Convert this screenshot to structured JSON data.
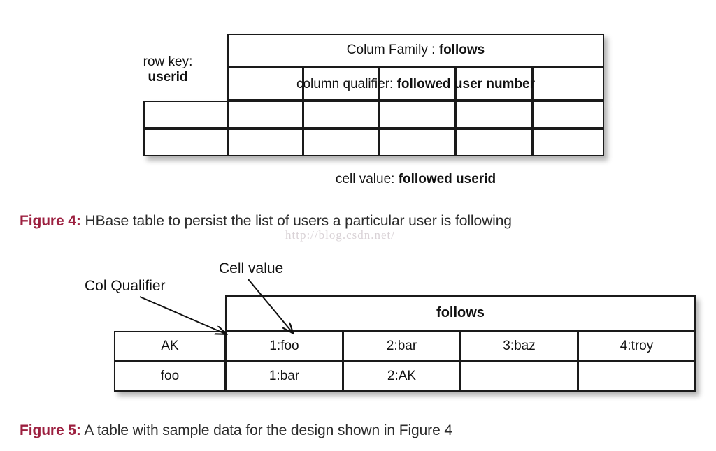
{
  "page": {
    "background": "#ffffff",
    "accent_color": "#9c1f3f",
    "ink_color": "#111111",
    "watermark": "http://blog.csdn.net/"
  },
  "figure4": {
    "row_key_label_line1": "row key:",
    "row_key_label_line2": "userid",
    "column_family_prefix": "Colum Family : ",
    "column_family_value": "follows",
    "column_qualifier_prefix": "column qualifier: ",
    "column_qualifier_value": "followed user number",
    "cell_value_prefix": "cell value: ",
    "cell_value_value": "followed userid",
    "grid": {
      "columns": 5,
      "data_rows": 2,
      "data_cells": [
        [
          "",
          "",
          "",
          "",
          "",
          ""
        ],
        [
          "",
          "",
          "",
          "",
          "",
          ""
        ]
      ]
    },
    "caption": {
      "number": "Figure 4:",
      "text": " HBase table to persist the list of users a particular user is following"
    }
  },
  "figure5": {
    "annotations": [
      {
        "name": "col-qualifier",
        "text": "Col Qualifier"
      },
      {
        "name": "cell-value",
        "text": "Cell value"
      }
    ],
    "column_family_header": "follows",
    "rows": [
      {
        "row_key": "AK",
        "cells": [
          "1:foo",
          "2:bar",
          "3:baz",
          "4:troy"
        ]
      },
      {
        "row_key": "foo",
        "cells": [
          "1:bar",
          "2:AK",
          "",
          ""
        ]
      }
    ],
    "caption": {
      "number": "Figure 5:",
      "text": " A table with sample data for the design shown in Figure 4"
    }
  }
}
